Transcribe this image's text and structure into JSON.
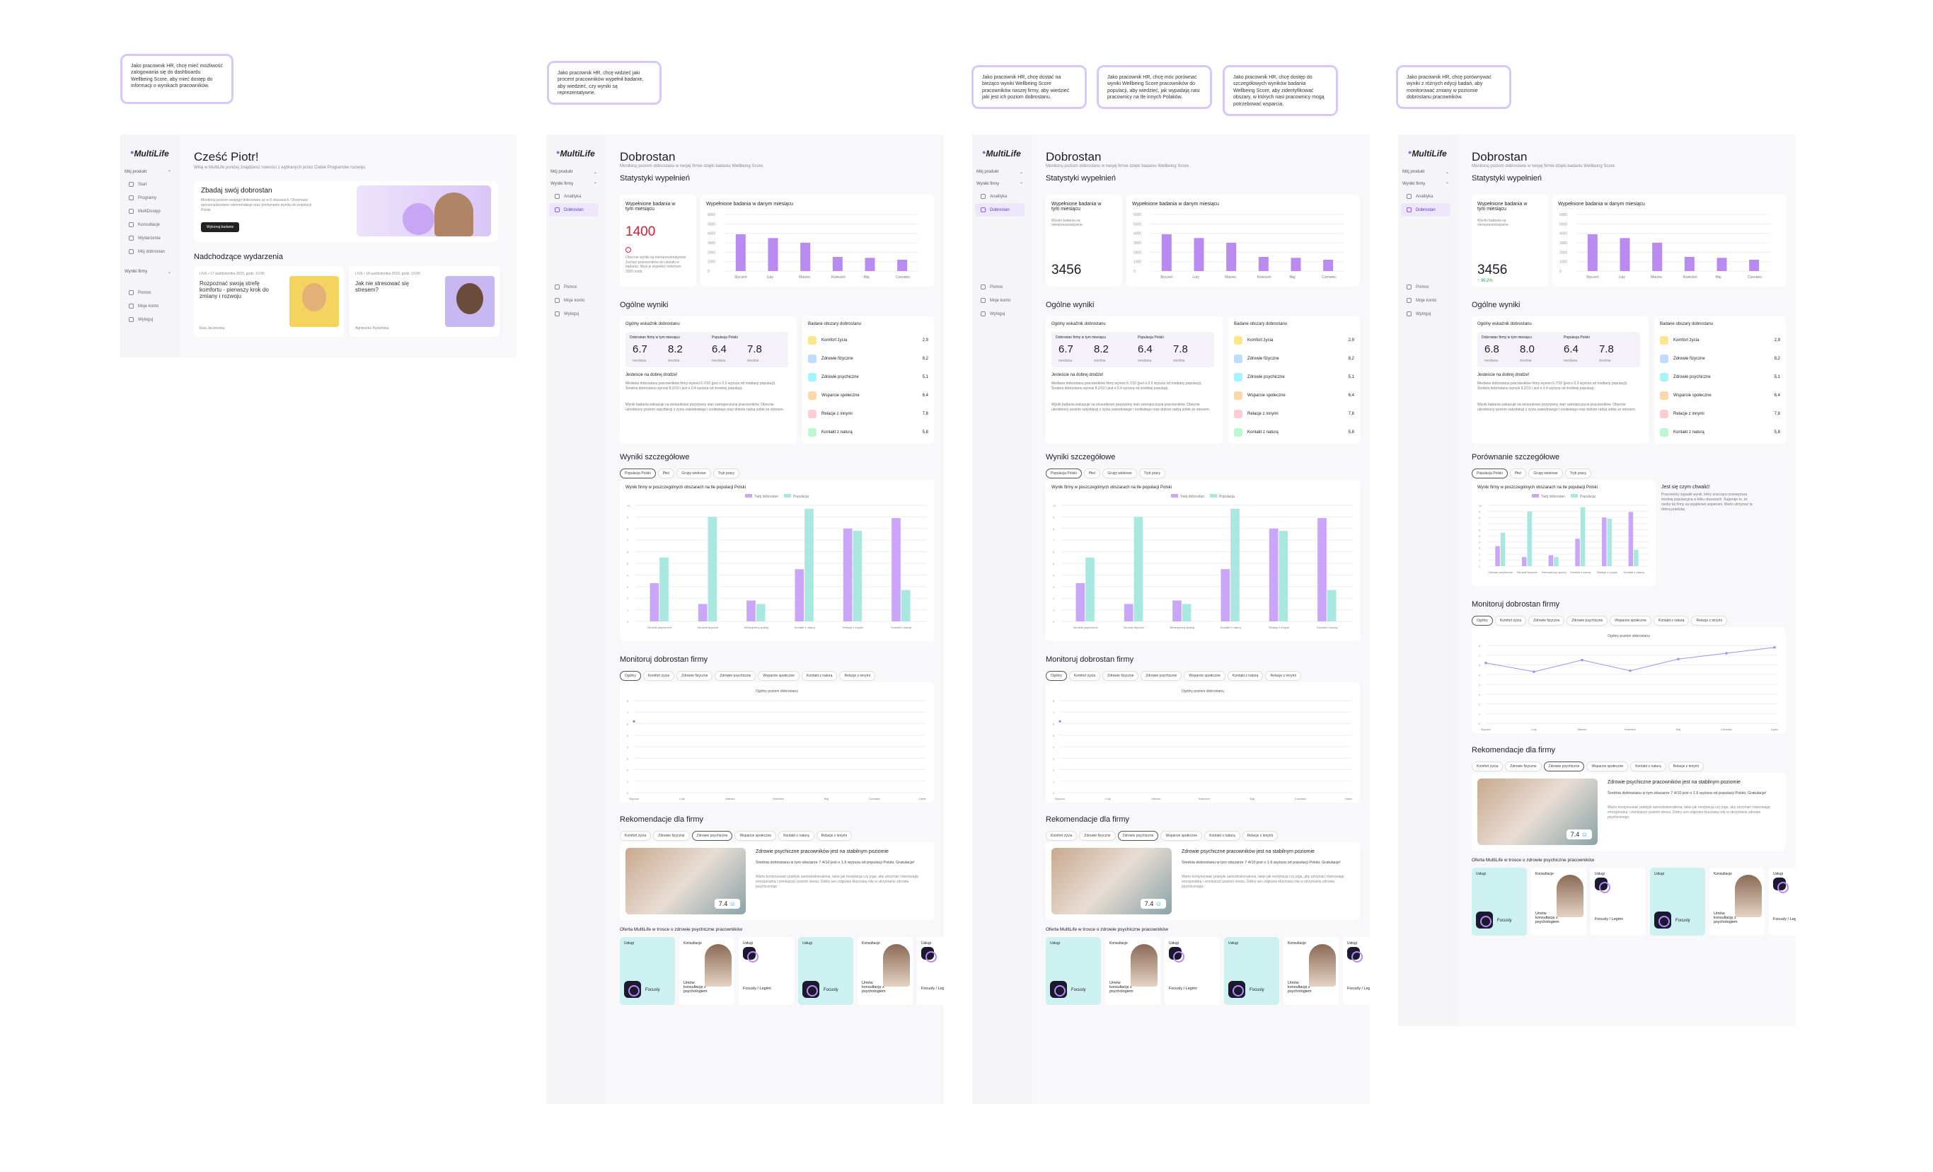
{
  "notes": [
    "Jako pracownik HR, chcę mieć możliwość zalogowania się do dashboardu Wellbeing Score, aby mieć dostęp do informacji o wynikach pracowników.",
    "Jako pracownik HR, chcę widzieć jaki procent pracowników wypełnił badanie, aby wiedzieć, czy wyniki są reprezentatywne.",
    "Jako pracownik HR, chcę dostać na bieżąco wyniki Wellbeing Score pracowników naszej firmy, aby wiedzieć jaki jest ich poziom dobrostanu.",
    "Jako pracownik HR, chcę móc porównać wyniki Wellbeing Score pracowników do populacji, aby wiedzieć, jak wypadają nasi pracownicy na tle innych Polaków.",
    "Jako pracownik HR, chcę dostęp do szczegółowych wyników badania Wellbeing Score, aby zidentyfikować obszary, w których nasi pracownicy mogą potrzebować wsparcia.",
    "Jako pracownik HR, chcę porównywać wyniki z różnych edycji badań, aby monitorować zmiany w poziomie dobrostanu pracowników."
  ],
  "sidebar": {
    "logo": "MultiLife",
    "my_products": "Mój produkt",
    "company_results": "Wyniki firmy",
    "items": [
      "Start",
      "Programy",
      "MultiDostęp",
      "Konsultacje",
      "Wydarzenia",
      "Mój dobrostan"
    ],
    "company_items": [
      "Analityka",
      "Dobrostan"
    ],
    "footer": [
      "Pomoc",
      "Moje konto",
      "Wyloguj"
    ]
  },
  "home": {
    "greeting": "Cześć Piotr!",
    "welcome": "Witaj w MultiLife poniżej znajdziesz nowości z wybranych przez Ciebie Programów rozwoju.",
    "promo_title": "Zbadaj swój dobrostan",
    "promo_text": "Monitoruj poziom swojego dobrostanu aż w 6 obszarach. Otrzymasz spersonalizowane rekomendacje oraz porównanie wyniku do populacji Polski.",
    "promo_button": "Wykonaj badanie",
    "events_title": "Nadchodzące wydarzenia",
    "events": [
      {
        "meta": "LIVE • 17 października 2023, godz. 10:00",
        "title": "Rozpoznać swoją strefę komfortu - pierwszy krok do zmiany i rozwoju",
        "author": "Ewa Jaczewska"
      },
      {
        "meta": "LIVE • 18 października 2023, godz. 10:00",
        "title": "Jak nie stresować się stresem?",
        "author": "Agnieszka Rydzińska"
      }
    ]
  },
  "wellbeing": {
    "title": "Dobrostan",
    "subtitle": "Monitoruj poziom dobrostanu w twojej firmie dzięki badaniu Wellbeing Score.",
    "stats_title": "Statystyki wypełnień",
    "filled_label": "Wypełnione badania w tym miesiącu",
    "filled_value_1": "1400",
    "filled_value_2": "3456",
    "filled_value_3": "3456",
    "filled_change": "↑ 30,2%",
    "warning": "Obecnie wyniki są niereprezentatywne. Zachęć pracowników do udziału w badaniu. Musi je wypełnić minimum 2000 osób.",
    "low_sample": "Wyniki badania są niereprezentatywne.",
    "monthly_title": "Wypełnione badania w danym miesiącu",
    "months": [
      "Styczeń",
      "Luty",
      "Marzec",
      "Kwiecień",
      "Maj",
      "Czerwiec"
    ],
    "general_title": "Ogólne wyniki",
    "index_title": "Ogólny wskaźnik dobrostanu",
    "company_label": "Dobrostan firmy w tym miesiącu",
    "population_label": "Populacja Polski",
    "company_median": "6.7",
    "company_mean": "8.2",
    "company_median_v3": "6.8",
    "company_mean_v3": "8.0",
    "pop_median": "6.4",
    "pop_mean": "7.8",
    "median_label": "mediana",
    "mean_label": "średnia",
    "verdict_title": "Jesteście na dobrej drodze!",
    "verdict_text": "Mediana dobrostanu pracowników firmy wynosi 6.7/10 (jest o 0.3 wyższa od mediany populacji). Średnia dobrostanu wynosi 8.2/10 i jest o 0.4 wyższa od średniej populacji.",
    "verdict_text2": "Wynik badania wskazuje na stosunkowo pozytywny stan samopoczucia pracowników. Obecnie uśredniony poziom satysfakcji z życia zawodowego i osobistego oraz dobrze radzą sobie ze stresem.",
    "areas_title": "Badane obszary dobrostanu",
    "areas": [
      {
        "name": "Komfort życia",
        "score": "2,9",
        "color": "#fde68a"
      },
      {
        "name": "Zdrowie fizyczne",
        "score": "8,2",
        "color": "#bfdbfe"
      },
      {
        "name": "Zdrowie psychiczne",
        "score": "5,1",
        "color": "#a5f3fc"
      },
      {
        "name": "Wsparcie społeczne",
        "score": "6,4",
        "color": "#fed7aa"
      },
      {
        "name": "Relacje z innymi",
        "score": "7,8",
        "color": "#fecdd3"
      },
      {
        "name": "Kontakt z naturą",
        "score": "5,8",
        "color": "#bbf7d0"
      }
    ],
    "detail_title": "Wyniki szczegółowe",
    "compare_title": "Porównanie szczegółowe",
    "detail_tabs": [
      "Populacja Polski",
      "Płeć",
      "Grupy wiekowe",
      "Tryb pracy"
    ],
    "detail_chart_title": "Wynik firmy w poszczególnych obszarach na tle populacji Polski",
    "legend_company": "Twój dobrostan",
    "legend_population": "Populacja",
    "tip_title": "Jest się czym chwalić!",
    "tip_text": "Pracownicy wypadli wynik, który znacząco przewyższa średnią populacyjną w kilku obszarach. Sugeruje to, że osoby tej firmy są wyjątkowo wspierani. Warto utrzymać tę dobrą praktykę.",
    "monitor_title": "Monitoruj dobrostan firmy",
    "monitor_tabs": [
      "Ogólny",
      "Komfort życia",
      "Zdrowie fizyczne",
      "Zdrowie psychiczne",
      "Wsparcie społeczne",
      "Kontakt z naturą",
      "Relacje z innymi"
    ],
    "monitor_legend": "Ogólny poziom dobrostanu",
    "year_months": [
      "Styczeń",
      "Luty",
      "Marzec",
      "Kwiecień",
      "Maj",
      "Czerwiec",
      "Lipiec"
    ],
    "reco_title": "Rekomendacje dla firmy",
    "reco_tabs": [
      "Komfort życia",
      "Zdrowie fizyczne",
      "Zdrowie psychiczne",
      "Wsparcie społeczne",
      "Kontakt z naturą",
      "Relacje z innymi"
    ],
    "reco_heading": "Zdrowie psychiczne pracowników jest na stabilnym poziomie",
    "reco_sub": "Średnia dobrostanu w tym obszarze 7.4/10 jest o 1.6 wyższa od populacji Polski. Gratulacje!",
    "reco_text": "Warto kontynuować praktyki samodoskonalenia, takie jak medytacja czy joga, aby utrzymać równowagę emocjonalną i zmniejszyć poziom stresu. Dobry sen odgrywa kluczową rolę w utrzymaniu zdrowia psychicznego.",
    "reco_score": "7.4",
    "offer_title": "Oferta MultiLife w trosce o zdrowie psychiczne pracowników",
    "offer_services": "Usługi",
    "offer_consult": "Konsultacje",
    "offer_focusly": "Focusly",
    "offer_consult_text": "Umów konsultację z psychologiem",
    "offer_legimi": "Focusly / Legimi"
  },
  "chart_data": [
    {
      "type": "bar",
      "title": "Wypełnione badania w danym miesiącu",
      "categories": [
        "Styczeń",
        "Luty",
        "Marzec",
        "Kwiecień",
        "Maj",
        "Czerwiec"
      ],
      "values": [
        3900,
        3500,
        3000,
        1500,
        1400,
        1200
      ],
      "ylim": [
        0,
        6000
      ]
    },
    {
      "type": "bar",
      "title": "Wynik firmy w poszczególnych obszarach na tle populacji Polski",
      "categories": [
        "Zdrowie psychiczne",
        "Zdrowie fizyczne",
        "Wewnętrzny spokój",
        "Kontakt z naturą",
        "Relacje z innymi",
        "Kontakt z naturą"
      ],
      "series": [
        {
          "name": "Twój dobrostan",
          "values": [
            3.3,
            1.5,
            1.8,
            4.5,
            8,
            8.9
          ]
        },
        {
          "name": "Populacja",
          "values": [
            5.5,
            9,
            1.5,
            9.7,
            7.8,
            2.7
          ]
        }
      ],
      "ylim": [
        0,
        10
      ]
    },
    {
      "type": "line",
      "title": "Ogólny poziom dobrostanu",
      "categories": [
        "Styczeń",
        "Luty",
        "Marzec",
        "Kwiecień",
        "Maj",
        "Czerwiec",
        "Lipiec"
      ],
      "values": [
        6.2,
        5.3,
        6.5,
        5.4,
        6.6,
        7.2,
        7.8
      ],
      "ylim": [
        0,
        8
      ]
    }
  ]
}
